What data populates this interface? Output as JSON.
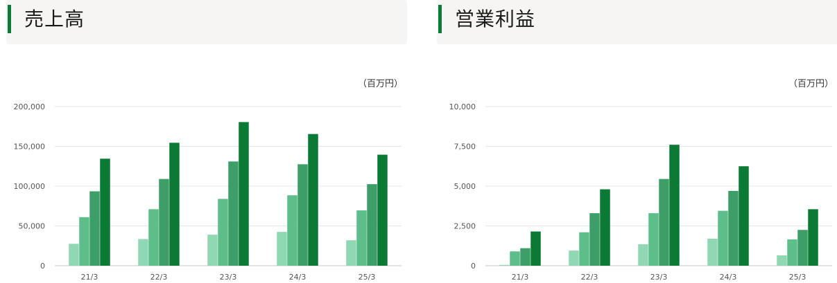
{
  "colors": [
    "#90d7b3",
    "#5dbe8a",
    "#3d9e68",
    "#0a7a35"
  ],
  "charts": [
    {
      "title": "売上高",
      "unit": "（百万円）",
      "chart_data": {
        "type": "bar",
        "categories": [
          "21/3",
          "22/3",
          "23/3",
          "24/3",
          "25/3"
        ],
        "series": [
          {
            "values": [
              27500,
              33500,
              39000,
              42500,
              32000
            ]
          },
          {
            "values": [
              61000,
              71000,
              84000,
              88500,
              69500
            ]
          },
          {
            "values": [
              93500,
              109000,
              131000,
              127500,
              102500
            ]
          },
          {
            "values": [
              134500,
              154500,
              180500,
              165500,
              139500
            ]
          }
        ],
        "ylim": [
          0,
          200000
        ],
        "yticks": [
          "0",
          "50,000",
          "100,000",
          "150,000",
          "200,000"
        ],
        "xlabel": "",
        "ylabel": "",
        "grid": true
      }
    },
    {
      "title": "営業利益",
      "unit": "（百万円）",
      "chart_data": {
        "type": "bar",
        "categories": [
          "21/3",
          "22/3",
          "23/3",
          "24/3",
          "25/3"
        ],
        "series": [
          {
            "values": [
              50,
              950,
              1350,
              1700,
              650
            ]
          },
          {
            "values": [
              900,
              2100,
              3300,
              3450,
              1650
            ]
          },
          {
            "values": [
              1100,
              3300,
              5450,
              4700,
              2250
            ]
          },
          {
            "values": [
              2150,
              4800,
              7600,
              6250,
              3550
            ]
          }
        ],
        "ylim": [
          0,
          10000
        ],
        "yticks": [
          "0",
          "2,500",
          "5,000",
          "7,500",
          "10,000"
        ],
        "xlabel": "",
        "ylabel": "",
        "grid": true
      }
    }
  ]
}
